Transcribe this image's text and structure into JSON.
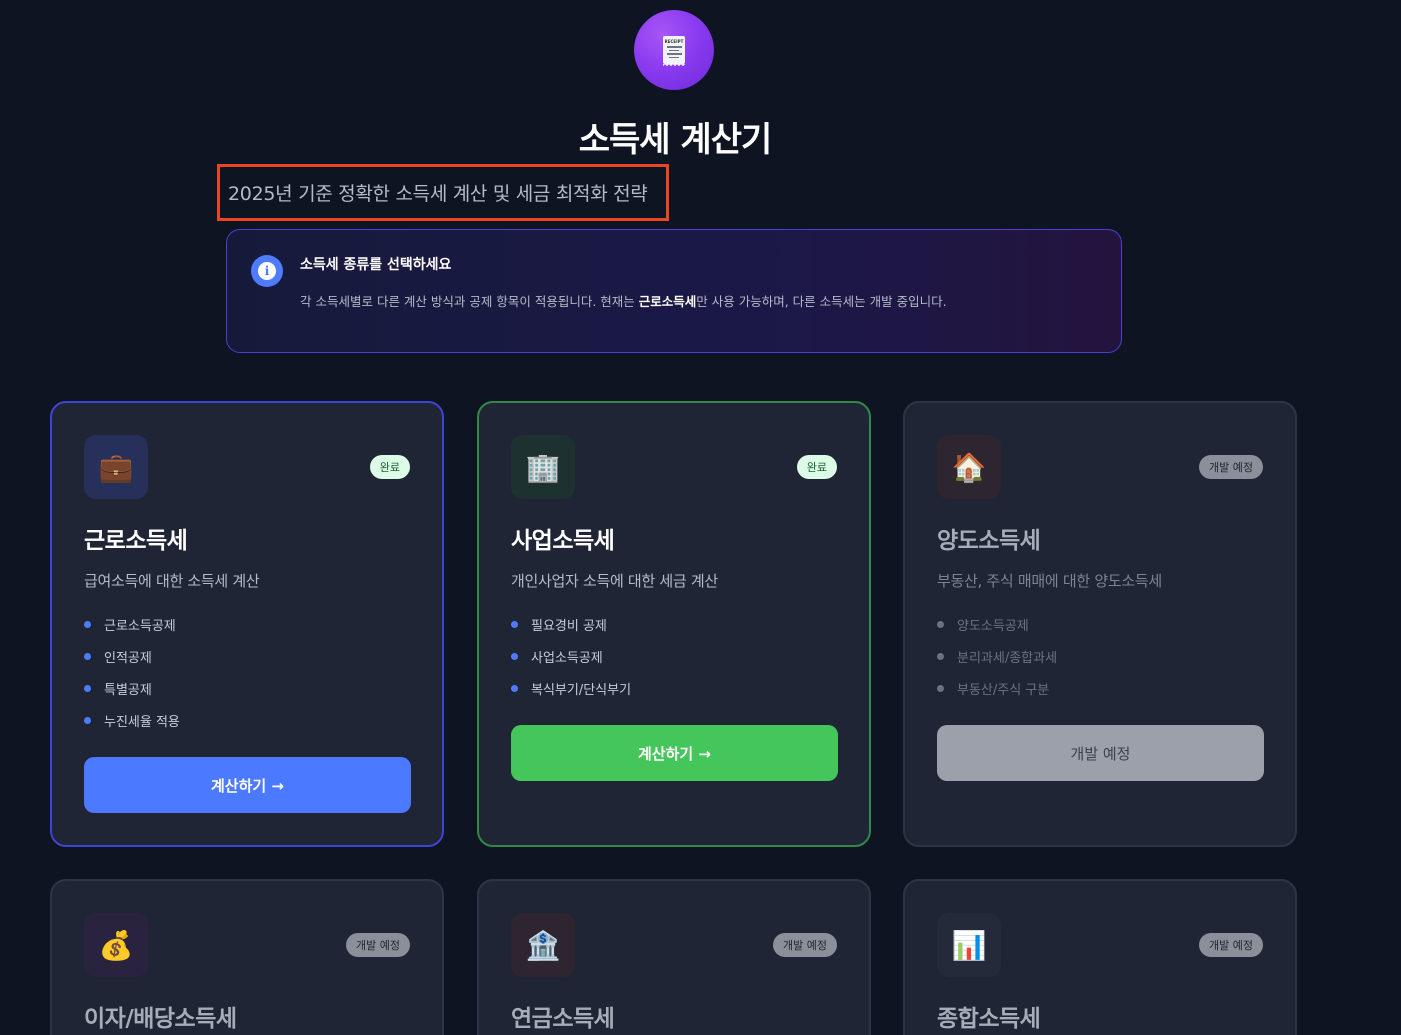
{
  "header": {
    "logo_icon": "receipt-icon",
    "logo_label": "RECEIPT",
    "title": "소득세 계산기",
    "subtitle": "2025년 기준 정확한 소득세 계산 및 세금 최적화 전략"
  },
  "info": {
    "icon": "info-icon",
    "title": "소득세 종류를 선택하세요",
    "desc_before": "각 소득세별로 다른 계산 방식과 공제 항목이 적용됩니다. 현재는 ",
    "desc_bold": "근로소득세",
    "desc_after": "만 사용 가능하며, 다른 소득세는 개발 중입니다."
  },
  "cards": [
    {
      "icon": "briefcase-icon",
      "glyph": "💼",
      "badge": "완료",
      "title": "근로소득세",
      "desc": "급여소득에 대한 소득세 계산",
      "features": [
        "근로소득공제",
        "인적공제",
        "특별공제",
        "누진세율 적용"
      ],
      "button": "계산하기 →"
    },
    {
      "icon": "office-building-icon",
      "glyph": "🏢",
      "badge": "완료",
      "title": "사업소득세",
      "desc": "개인사업자 소득에 대한 세금 계산",
      "features": [
        "필요경비 공제",
        "사업소득공제",
        "복식부기/단식부기"
      ],
      "button": "계산하기 →"
    },
    {
      "icon": "house-icon",
      "glyph": "🏠",
      "badge": "개발 예정",
      "title": "양도소득세",
      "desc": "부동산, 주식 매매에 대한 양도소득세",
      "features": [
        "양도소득공제",
        "분리과세/종합과세",
        "부동산/주식 구분"
      ],
      "button": "개발 예정"
    },
    {
      "icon": "money-bag-icon",
      "glyph": "💰",
      "badge": "개발 예정",
      "title": "이자/배당소득세"
    },
    {
      "icon": "bank-icon",
      "glyph": "🏦",
      "badge": "개발 예정",
      "title": "연금소득세"
    },
    {
      "icon": "bar-chart-icon",
      "glyph": "📊",
      "badge": "개발 예정",
      "title": "종합소득세"
    }
  ],
  "colors": {
    "background": "#0f1423",
    "accent_blue": "#4b79ff",
    "accent_green": "#45c65a",
    "highlight_border": "#e8471f"
  }
}
